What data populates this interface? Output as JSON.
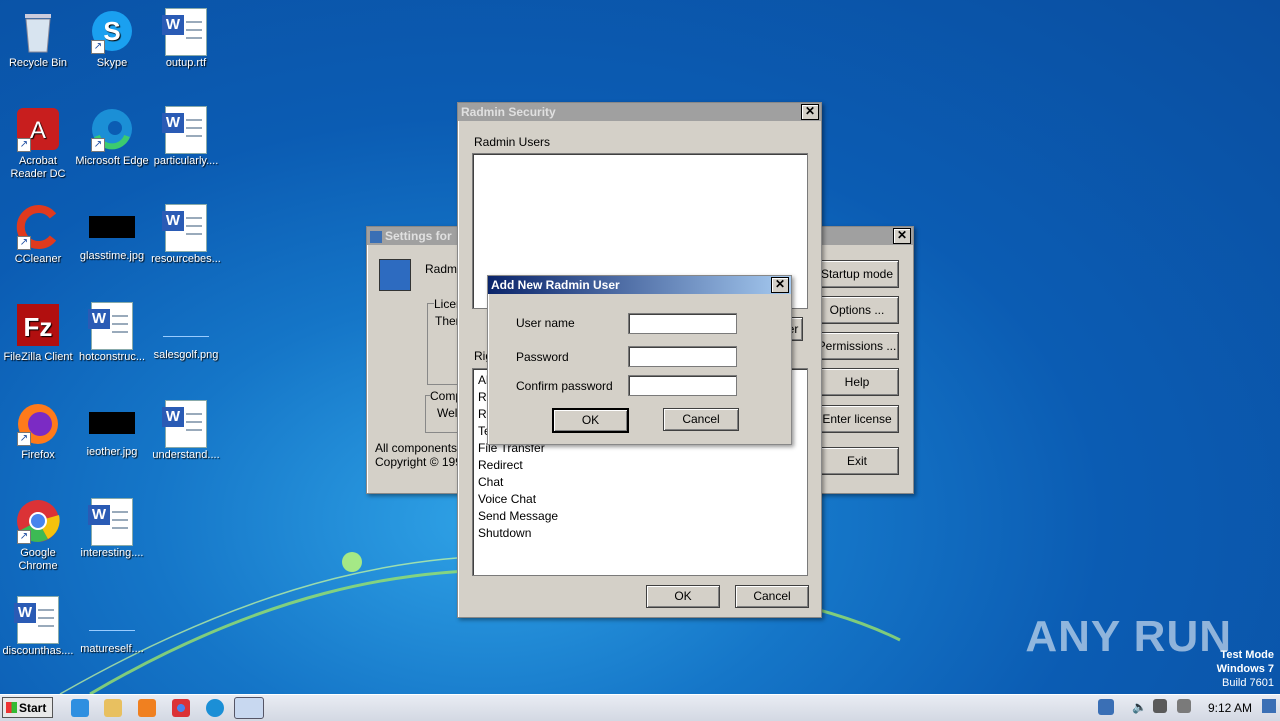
{
  "desktop_icons": [
    {
      "label": "Recycle Bin",
      "icon": "recycle-bin-icon"
    },
    {
      "label": "Skype",
      "icon": "skype-icon"
    },
    {
      "label": "outup.rtf",
      "icon": "word-document-icon"
    },
    {
      "label": "Acrobat Reader DC",
      "icon": "acrobat-icon"
    },
    {
      "label": "Microsoft Edge",
      "icon": "edge-icon"
    },
    {
      "label": "particularly....",
      "icon": "word-document-icon"
    },
    {
      "label": "CCleaner",
      "icon": "ccleaner-icon"
    },
    {
      "label": "glasstime.jpg",
      "icon": "image-file-icon"
    },
    {
      "label": "resourcebes...",
      "icon": "word-document-icon"
    },
    {
      "label": "FileZilla Client",
      "icon": "filezilla-icon"
    },
    {
      "label": "hotconstruc...",
      "icon": "word-document-icon"
    },
    {
      "label": "salesgolf.png",
      "icon": "image-file-icon"
    },
    {
      "label": "Firefox",
      "icon": "firefox-icon"
    },
    {
      "label": "ieother.jpg",
      "icon": "image-file-icon"
    },
    {
      "label": "understand....",
      "icon": "word-document-icon"
    },
    {
      "label": "Google Chrome",
      "icon": "chrome-icon"
    },
    {
      "label": "interesting....",
      "icon": "word-document-icon"
    },
    {
      "label": "discounthas....",
      "icon": "word-document-icon"
    },
    {
      "label": "matureself....",
      "icon": "image-file-icon"
    }
  ],
  "settings_window": {
    "title": "Settings for",
    "radmin_label": "Radmi",
    "license_group": "Licen",
    "license_text": "Ther",
    "components_group": "Comp",
    "components_text": "Wel",
    "all_components": "All components fr",
    "copyright": "Copyright © 1999",
    "buttons": [
      "Startup mode ...",
      "Options ...",
      "Permissions ...",
      "Help",
      "Enter license",
      "Exit"
    ]
  },
  "security_window": {
    "title": "Radmin Security",
    "users_label": "Radmin Users",
    "rights_label": "Rig",
    "partial_button": "er",
    "rights": [
      "Al",
      "R",
      "R",
      "Te",
      "File Transfer",
      "Redirect",
      "Chat",
      "Voice Chat",
      "Send Message",
      "Shutdown"
    ],
    "ok": "OK",
    "cancel": "Cancel"
  },
  "add_user_dialog": {
    "title": "Add New Radmin User",
    "username_label": "User name",
    "username_value": "",
    "password_label": "Password",
    "password_value": "",
    "confirm_label": "Confirm password",
    "confirm_value": "",
    "ok": "OK",
    "cancel": "Cancel"
  },
  "taskbar": {
    "start": "Start",
    "clock": "9:12 AM"
  },
  "watermark": "ANY RUN",
  "test_mode": {
    "line1": "Test Mode",
    "line2": "Windows 7",
    "line3": "Build 7601"
  }
}
